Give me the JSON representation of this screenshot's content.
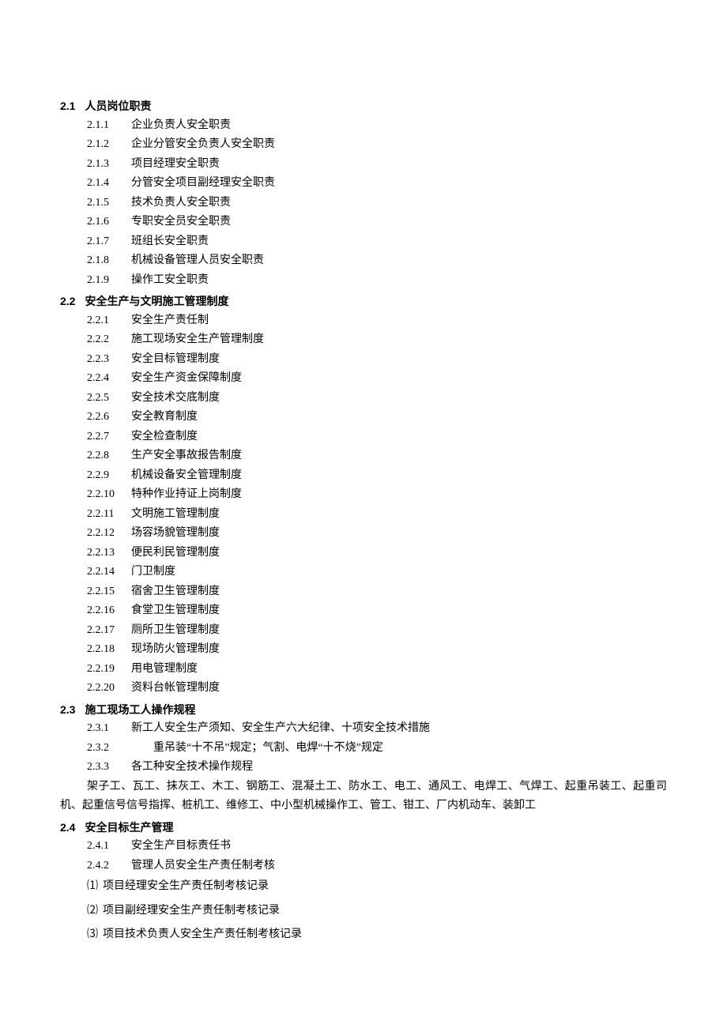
{
  "sections": {
    "s21": {
      "num": "2.1",
      "title": "人员岗位职责"
    },
    "s22": {
      "num": "2.2",
      "title": "安全生产与文明施工管理制度"
    },
    "s23": {
      "num": "2.3",
      "title": "施工现场工人操作规程"
    },
    "s24": {
      "num": "2.4",
      "title": "安全目标生产管理"
    }
  },
  "s21_items": {
    "i0": {
      "num": "2.1.1",
      "text": "企业负责人安全职责"
    },
    "i1": {
      "num": "2.1.2",
      "text": "企业分管安全负责人安全职责"
    },
    "i2": {
      "num": "2.1.3",
      "text": "项目经理安全职责"
    },
    "i3": {
      "num": "2.1.4",
      "text": "分管安全项目副经理安全职责"
    },
    "i4": {
      "num": "2.1.5",
      "text": "技术负责人安全职责"
    },
    "i5": {
      "num": "2.1.6",
      "text": "专职安全员安全职责"
    },
    "i6": {
      "num": "2.1.7",
      "text": "班组长安全职责"
    },
    "i7": {
      "num": "2.1.8",
      "text": "机械设备管理人员安全职责"
    },
    "i8": {
      "num": "2.1.9",
      "text": "操作工安全职责"
    }
  },
  "s22_items": {
    "i0": {
      "num": "2.2.1",
      "text": "安全生产责任制"
    },
    "i1": {
      "num": "2.2.2",
      "text": "施工现场安全生产管理制度"
    },
    "i2": {
      "num": "2.2.3",
      "text": "安全目标管理制度"
    },
    "i3": {
      "num": "2.2.4",
      "text": "安全生产资金保障制度"
    },
    "i4": {
      "num": "2.2.5",
      "text": "安全技术交底制度"
    },
    "i5": {
      "num": "2.2.6",
      "text": "安全教育制度"
    },
    "i6": {
      "num": "2.2.7",
      "text": "安全检查制度"
    },
    "i7": {
      "num": "2.2.8",
      "text": "生产安全事故报告制度"
    },
    "i8": {
      "num": "2.2.9",
      "text": "机械设备安全管理制度"
    },
    "i9": {
      "num": "2.2.10",
      "text": "特种作业持证上岗制度"
    },
    "i10": {
      "num": "2.2.11",
      "text": "文明施工管理制度"
    },
    "i11": {
      "num": "2.2.12",
      "text": "场容场貌管理制度"
    },
    "i12": {
      "num": "2.2.13",
      "text": "便民利民管理制度"
    },
    "i13": {
      "num": "2.2.14",
      "text": "门卫制度"
    },
    "i14": {
      "num": "2.2.15",
      "text": "宿舍卫生管理制度"
    },
    "i15": {
      "num": "2.2.16",
      "text": "食堂卫生管理制度"
    },
    "i16": {
      "num": "2.2.17",
      "text": "厕所卫生管理制度"
    },
    "i17": {
      "num": "2.2.18",
      "text": "现场防火管理制度"
    },
    "i18": {
      "num": "2.2.19",
      "text": "用电管理制度"
    },
    "i19": {
      "num": "2.2.20",
      "text": "资料台帐管理制度"
    }
  },
  "s23_items": {
    "i0": {
      "num": "2.3.1",
      "text": "新工人安全生产须知、安全生产六大纪律、十项安全技术措施"
    },
    "i1": {
      "num": "2.3.2",
      "text": "　　重吊装“十不吊”规定；气割、电焊“十不烧”规定"
    },
    "i2": {
      "num": "2.3.3",
      "text": "各工种安全技术操作规程"
    },
    "para": "架子工、瓦工、抹灰工、木工、钢筋工、混凝土工、防水工、电工、通风工、电焊工、气焊工、起重吊装工、起重司机、起重信号信号指挥、桩机工、维修工、中小型机械操作工、管工、钳工、厂内机动车、装卸工"
  },
  "s24_items": {
    "i0": {
      "num": "2.4.1",
      "text": "安全生产目标责任书"
    },
    "i1": {
      "num": "2.4.2",
      "text": "管理人员安全生产责任制考核"
    }
  },
  "s24_subitems": {
    "j0": {
      "num": "⑴",
      "text": "项目经理安全生产责任制考核记录"
    },
    "j1": {
      "num": "⑵",
      "text": "项目副经理安全生产责任制考核记录"
    },
    "j2": {
      "num": "⑶",
      "text": "项目技术负责人安全生产责任制考核记录"
    }
  }
}
